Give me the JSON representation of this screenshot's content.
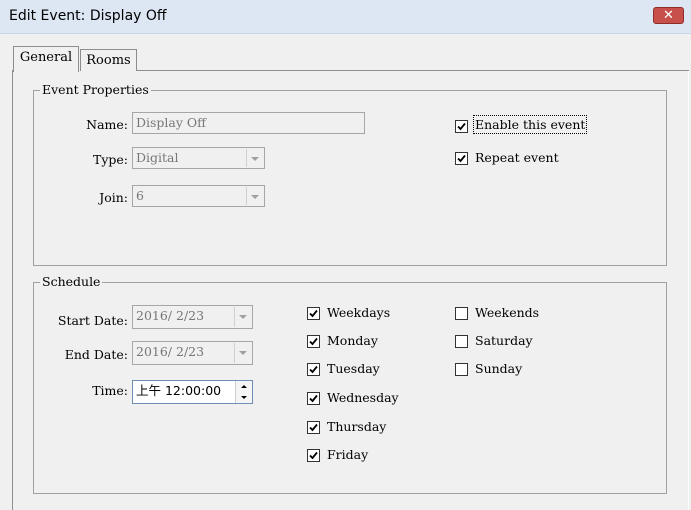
{
  "window": {
    "title": "Edit Event: Display Off",
    "close_glyph": "✕"
  },
  "tabs": [
    {
      "label": "General",
      "active": true
    },
    {
      "label": "Rooms",
      "active": false
    }
  ],
  "event_properties": {
    "legend": "Event Properties",
    "name_label": "Name:",
    "name_value": "Display Off",
    "type_label": "Type:",
    "type_value": "Digital",
    "join_label": "Join:",
    "join_value": "6",
    "enable_label": "Enable this event",
    "enable_checked": true,
    "repeat_label": "Repeat event",
    "repeat_checked": true
  },
  "schedule": {
    "legend": "Schedule",
    "start_label": "Start Date:",
    "start_value": "2016/ 2/23",
    "end_label": "End Date:",
    "end_value": "2016/ 2/23",
    "time_label": "Time:",
    "time_value": "上午 12:00:00",
    "days": [
      {
        "label": "Weekdays",
        "checked": true
      },
      {
        "label": "Monday",
        "checked": true
      },
      {
        "label": "Tuesday",
        "checked": true
      },
      {
        "label": "Wednesday",
        "checked": true
      },
      {
        "label": "Thursday",
        "checked": true
      },
      {
        "label": "Friday",
        "checked": true
      },
      {
        "label": "Weekends",
        "checked": false
      },
      {
        "label": "Saturday",
        "checked": false
      },
      {
        "label": "Sunday",
        "checked": false
      }
    ]
  },
  "colors": {
    "titlebar": "#dde7f3",
    "close_button": "#c7514a",
    "background": "#f0f0f0"
  }
}
